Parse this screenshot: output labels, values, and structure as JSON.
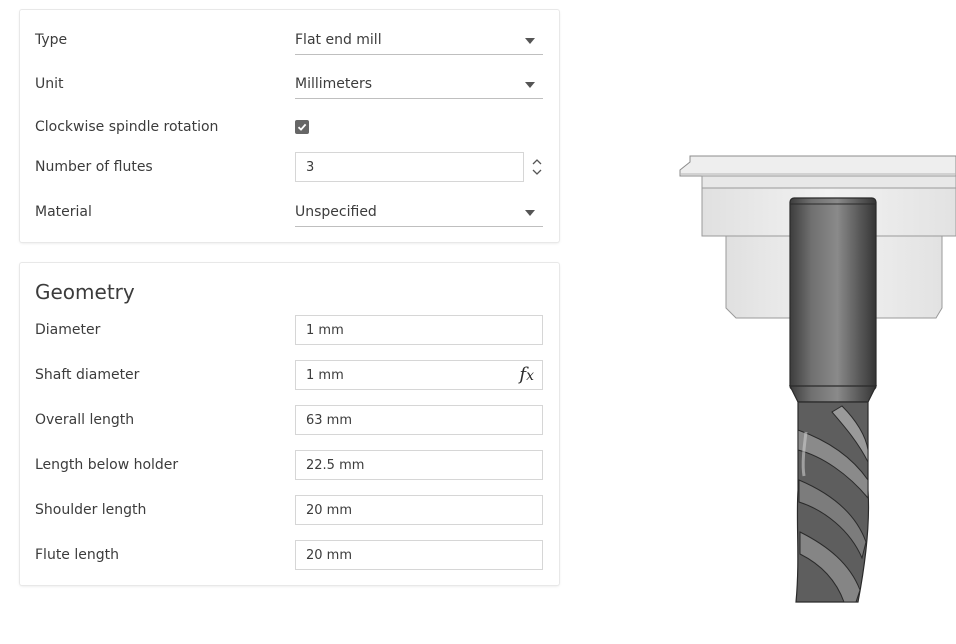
{
  "general": {
    "type": {
      "label": "Type",
      "value": "Flat end mill"
    },
    "unit": {
      "label": "Unit",
      "value": "Millimeters"
    },
    "clockwise": {
      "label": "Clockwise spindle rotation",
      "checked": true
    },
    "flutes": {
      "label": "Number of flutes",
      "value": "3"
    },
    "material": {
      "label": "Material",
      "value": "Unspecified"
    }
  },
  "geometry": {
    "title": "Geometry",
    "diameter": {
      "label": "Diameter",
      "value": "1 mm"
    },
    "shaft_diameter": {
      "label": "Shaft diameter",
      "value": "1 mm",
      "fx": "f",
      "fx_sub": "x"
    },
    "overall_length": {
      "label": "Overall length",
      "value": "63 mm"
    },
    "length_below_holder": {
      "label": "Length below holder",
      "value": "22.5 mm"
    },
    "shoulder_length": {
      "label": "Shoulder length",
      "value": "20 mm"
    },
    "flute_length": {
      "label": "Flute length",
      "value": "20 mm"
    }
  },
  "icons": {
    "dropdown": "chevron-down-icon",
    "stepper": "up-down-arrows-icon",
    "check": "checkmark-icon",
    "formula": "fx-icon"
  },
  "colors": {
    "checkbox": "#666666",
    "input_border": "#d6d6d6",
    "tool_body": "#5a5a5a",
    "holder": "#e6e6e6"
  }
}
